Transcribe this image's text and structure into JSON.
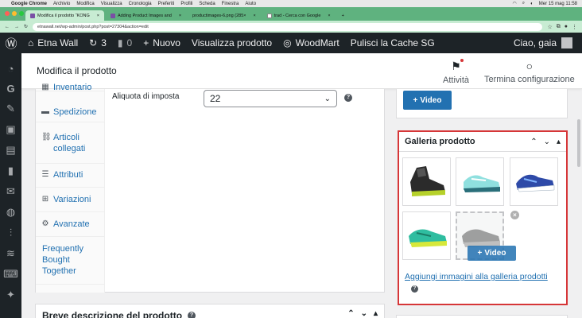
{
  "macbar": {
    "app": "Google Chrome",
    "menus": [
      "Archivio",
      "Modifica",
      "Visualizza",
      "Cronologia",
      "Preferiti",
      "Profili",
      "Scheda",
      "Finestra",
      "Aiuto"
    ],
    "clock": "Mer 15 mag 11:58"
  },
  "browser": {
    "tabs": [
      {
        "label": "Modifica il prodotto “KONG",
        "active": true
      },
      {
        "label": "Adding Product Images and",
        "active": false
      },
      {
        "label": "productimages-6.png (285×",
        "active": false
      },
      {
        "label": "trad - Cerca con Google",
        "active": false
      }
    ],
    "url": "etnawall.net/wp-admin/post.php?post=27304&action=edit"
  },
  "adminbar": {
    "site": "Etna Wall",
    "updates_count": "3",
    "comments_count": "0",
    "new_label": "Nuovo",
    "view_product": "Visualizza prodotto",
    "woodmart": "WoodMart",
    "purge_cache": "Pulisci la Cache SG",
    "greeting": "Ciao, gaia"
  },
  "header": {
    "title": "Modifica il prodotto",
    "activity": "Attività",
    "finish_setup": "Termina configurazione"
  },
  "product_data": {
    "nav": [
      {
        "label": "Inventario",
        "icon": "inventory-icon"
      },
      {
        "label": "Spedizione",
        "icon": "truck-icon"
      },
      {
        "label": "Articoli collegati",
        "icon": "link-icon"
      },
      {
        "label": "Attributi",
        "icon": "list-icon"
      },
      {
        "label": "Variazioni",
        "icon": "grid-icon"
      },
      {
        "label": "Avanzate",
        "icon": "gear-icon"
      },
      {
        "label": "Frequently Bought Together",
        "icon": ""
      }
    ],
    "tax_rate_label": "Aliquota di imposta",
    "tax_rate_value": "22"
  },
  "short_description": {
    "title": "Breve descrizione del prodotto"
  },
  "video_top": {
    "button": "Video"
  },
  "gallery": {
    "title": "Galleria prodotto",
    "video_button": "Video",
    "add_link": "Aggiungi immagini alla galleria prodotti"
  },
  "colors": {
    "wp_dark": "#1d2327",
    "wp_blue": "#2271b1",
    "highlight_red": "#d63638",
    "tab_green": "#5fb27f"
  }
}
